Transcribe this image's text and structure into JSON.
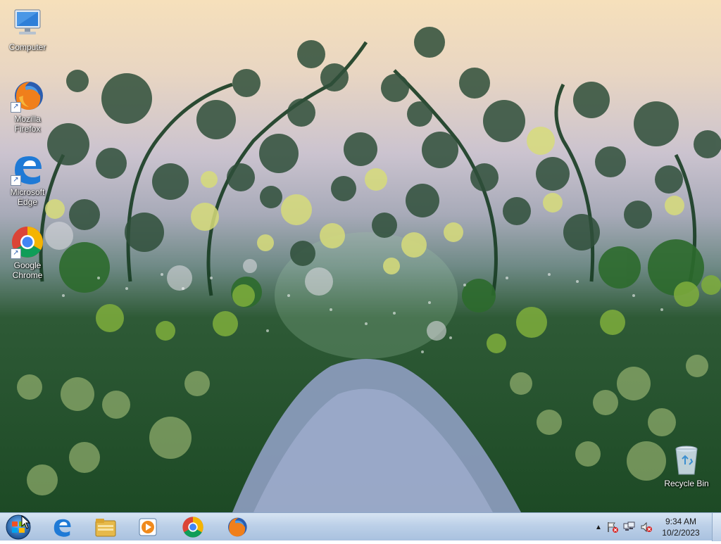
{
  "desktop": {
    "icons": [
      {
        "label_line1": "Computer",
        "label_line2": "",
        "icon": "computer-icon"
      },
      {
        "label_line1": "Mozilla",
        "label_line2": "Firefox",
        "icon": "firefox-icon"
      },
      {
        "label_line1": "Microsoft",
        "label_line2": "Edge",
        "icon": "edge-icon"
      },
      {
        "label_line1": "Google",
        "label_line2": "Chrome",
        "icon": "chrome-icon"
      },
      {
        "label_line1": "Recycle Bin",
        "label_line2": "",
        "icon": "recycle-bin-icon"
      }
    ]
  },
  "taskbar": {
    "start_icon": "windows-start-icon",
    "pinned": [
      "edge-icon",
      "file-explorer-icon",
      "media-player-icon",
      "chrome-icon",
      "firefox-icon"
    ],
    "tray_icons": [
      "chevron-up-icon",
      "action-center-flag-icon",
      "network-icon",
      "volume-muted-icon"
    ],
    "clock": {
      "time": "9:34 AM",
      "date": "10/2/2023"
    }
  },
  "colors": {
    "taskbar": "#bcd0e8",
    "accent": "#2a5db0"
  }
}
